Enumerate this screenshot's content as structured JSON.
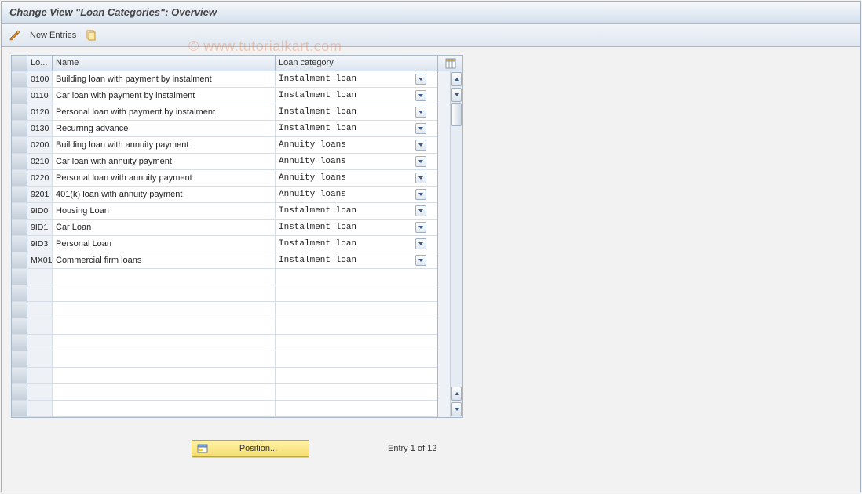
{
  "title": "Change View \"Loan Categories\": Overview",
  "toolbar": {
    "new_entries_label": "New Entries"
  },
  "watermark": "© www.tutorialkart.com",
  "grid": {
    "headers": {
      "code": "Lo...",
      "name": "Name",
      "category": "Loan category"
    },
    "rows": [
      {
        "code": "0100",
        "name": "Building loan with payment by instalment",
        "cat": "Instalment loan"
      },
      {
        "code": "0110",
        "name": "Car loan with payment by instalment",
        "cat": "Instalment loan"
      },
      {
        "code": "0120",
        "name": "Personal loan with payment by instalment",
        "cat": "Instalment loan"
      },
      {
        "code": "0130",
        "name": "Recurring advance",
        "cat": "Instalment loan"
      },
      {
        "code": "0200",
        "name": "Building loan with annuity payment",
        "cat": "Annuity loans"
      },
      {
        "code": "0210",
        "name": "Car loan with annuity payment",
        "cat": "Annuity loans"
      },
      {
        "code": "0220",
        "name": "Personal loan with annuity payment",
        "cat": "Annuity loans"
      },
      {
        "code": "9201",
        "name": "401(k) loan with annuity payment",
        "cat": "Annuity loans"
      },
      {
        "code": "9ID0",
        "name": "Housing Loan",
        "cat": "Instalment loan"
      },
      {
        "code": "9ID1",
        "name": "Car Loan",
        "cat": "Instalment loan"
      },
      {
        "code": "9ID3",
        "name": "Personal Loan",
        "cat": "Instalment loan"
      },
      {
        "code": "MX01",
        "name": "Commercial firm loans",
        "cat": "Instalment loan"
      }
    ],
    "empty_rows": 9
  },
  "footer": {
    "position_label": "Position...",
    "entry_text": "Entry 1 of 12"
  }
}
